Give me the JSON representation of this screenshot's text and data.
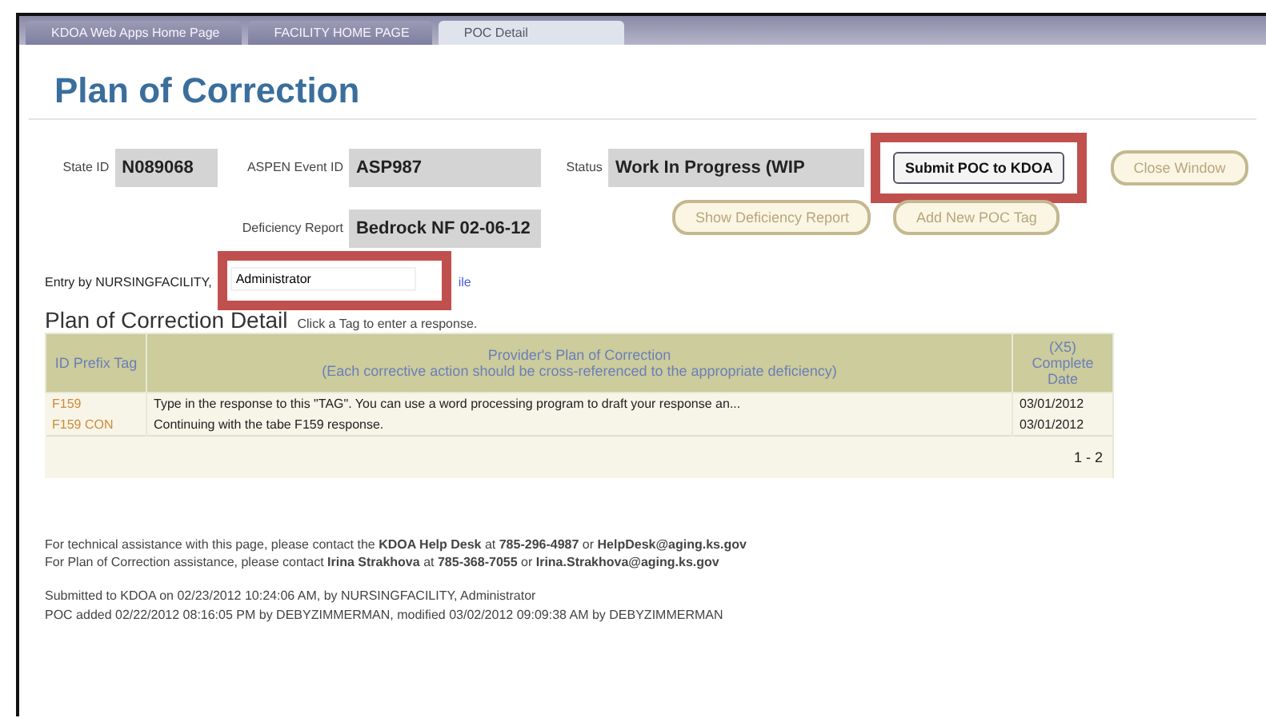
{
  "browser_tabs": [
    {
      "label": "KDOA Web Apps Home Page",
      "selected": false
    },
    {
      "label": "FACILITY HOME PAGE",
      "selected": false
    },
    {
      "label": "POC Detail",
      "selected": true
    }
  ],
  "title": "Plan of Correction",
  "fields": {
    "state_id": {
      "label": "State ID",
      "value": "N089068"
    },
    "event_id": {
      "label": "ASPEN Event ID",
      "value": "ASP987"
    },
    "status": {
      "label": "Status",
      "value": "Work In Progress (WIP"
    },
    "deficiency_report": {
      "label": "Deficiency Report",
      "value": "Bedrock NF 02-06-12"
    }
  },
  "buttons": [
    {
      "label": "Submit POC to KDOA",
      "kind": "primary",
      "highlighted": true
    },
    {
      "label": "Close Window",
      "kind": "secondary",
      "highlighted": false
    },
    {
      "label": "Show Deficiency Report",
      "kind": "secondary",
      "highlighted": false
    },
    {
      "label": "Add New POC Tag",
      "kind": "secondary",
      "highlighted": false
    }
  ],
  "entry": {
    "label": "Entry by NURSINGFACILITY,",
    "value": "Administrator",
    "highlighted": true,
    "link": "ile"
  },
  "details": {
    "heading": "Plan of Correction Detail",
    "hint": "Click a Tag to enter a response.",
    "columns": [
      "ID Prefix Tag",
      "Provider's Plan of Correction",
      "(Each corrective action should be cross-referenced to the appropriate deficiency)",
      "(X5) Complete Date"
    ],
    "rows": [
      {
        "tag": "F159",
        "response": "Type in the response to this \"TAG\". You can use a word processing program to draft your response an...",
        "date": "03/01/2012"
      },
      {
        "tag": "F159 CON",
        "response": "Continuing with the tabe F159 response.",
        "date": "03/01/2012"
      }
    ],
    "pager": "1 - 2"
  },
  "contact_lines": [
    "For technical assistance with this page, please contact the **KDOA Help Desk** at **785-296-4987** or **HelpDesk@aging.ks.gov**",
    "For Plan of Correction assistance, please contact **Irina Strakhova** at **785-368-7055** or **Irina.Strakhova@aging.ks.gov**"
  ],
  "history_lines": [
    "Submitted to KDOA on 02/23/2012 10:24:06 AM, by NURSINGFACILITY, Administrator",
    "POC added 02/22/2012 08:16:05 PM by DEBYZIMMERMAN, modified 03/02/2012 09:09:38 AM by DEBYZIMMERMAN"
  ]
}
